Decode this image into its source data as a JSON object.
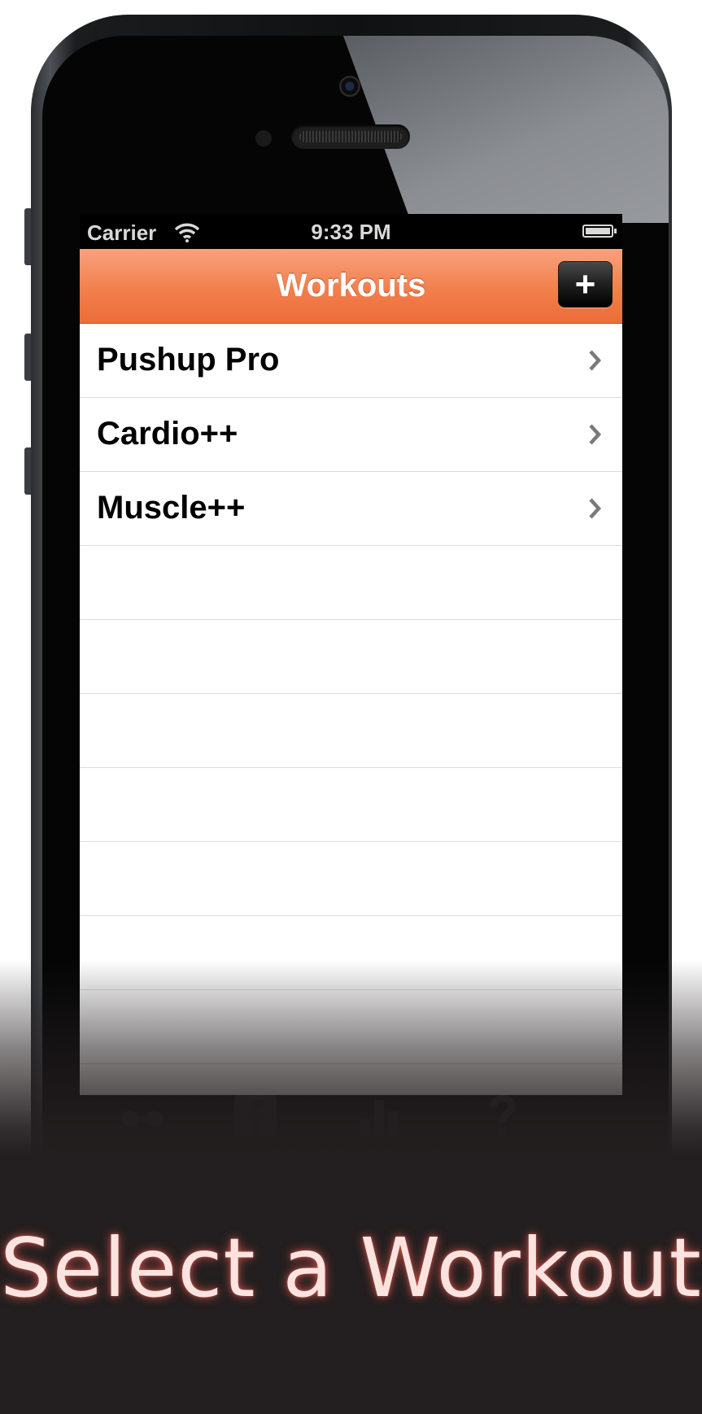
{
  "status_bar": {
    "carrier": "Carrier",
    "time": "9:33 PM",
    "wifi_icon": "wifi-icon",
    "battery_icon": "battery-icon"
  },
  "nav_bar": {
    "title": "Workouts",
    "add_label": "+",
    "accent_color": "#f27f4d"
  },
  "workouts": [
    {
      "label": "Pushup Pro"
    },
    {
      "label": "Cardio++"
    },
    {
      "label": "Muscle++"
    }
  ],
  "empty_rows": 7,
  "caption": "Select a Workout"
}
